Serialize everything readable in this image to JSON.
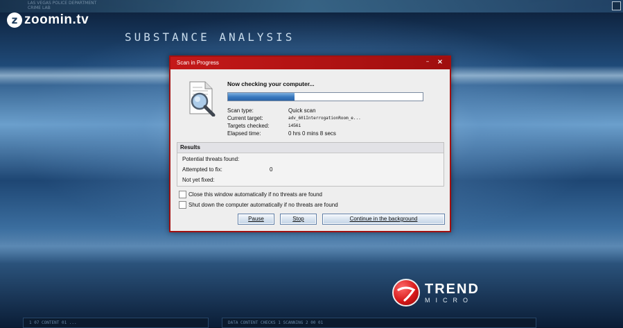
{
  "watermark": {
    "brand": "zoomin.tv",
    "mark": "z"
  },
  "top_bar": {
    "text_line1": "LAS VEGAS POLICE DEPARTMENT",
    "text_line2": "CRIME LAB"
  },
  "app": {
    "title": "SUBSTANCE ANALYSIS"
  },
  "dialog": {
    "title": "Scan in Progress",
    "minimize_label": "–",
    "close_label": "×",
    "heading": "Now checking your computer...",
    "progress": 0.34,
    "progress_fill_color": "#3b7bc0",
    "details": [
      {
        "label": "Scan type:",
        "value": "Quick scan"
      },
      {
        "label": "Current target:",
        "value": "adv_601InterrogationRoom_e..."
      },
      {
        "label": "Targets checked:",
        "value": "14561"
      },
      {
        "label": "Elapsed time:",
        "value": "0 hrs 0 mins 8 secs"
      }
    ],
    "results": {
      "header": "Results",
      "rows": [
        {
          "label": "Potential threats found:",
          "value": ""
        },
        {
          "label": "Attempted to fix:",
          "value": "0"
        },
        {
          "label": "Not yet fixed:",
          "value": ""
        }
      ]
    },
    "checkboxes": [
      {
        "label": "Close this window automatically if no threats are found",
        "checked": false
      },
      {
        "label": "Shut down the computer automatically if no threats are found",
        "checked": false
      }
    ],
    "buttons": {
      "pause": "Pause",
      "stop": "Stop",
      "continue": "Continue in the background"
    },
    "icon": "magnifier-document-icon",
    "accent_color": "#c41919"
  },
  "brand": {
    "line1": "TREND",
    "line2": "MICRO",
    "icon": "trend-micro-ball-icon"
  },
  "bottom_bar": {
    "left_text": "1 07      CONTENT 01      ...",
    "right_text": "DATA     CONTENT CHECKS     1     SCANNING     2     00 01"
  }
}
